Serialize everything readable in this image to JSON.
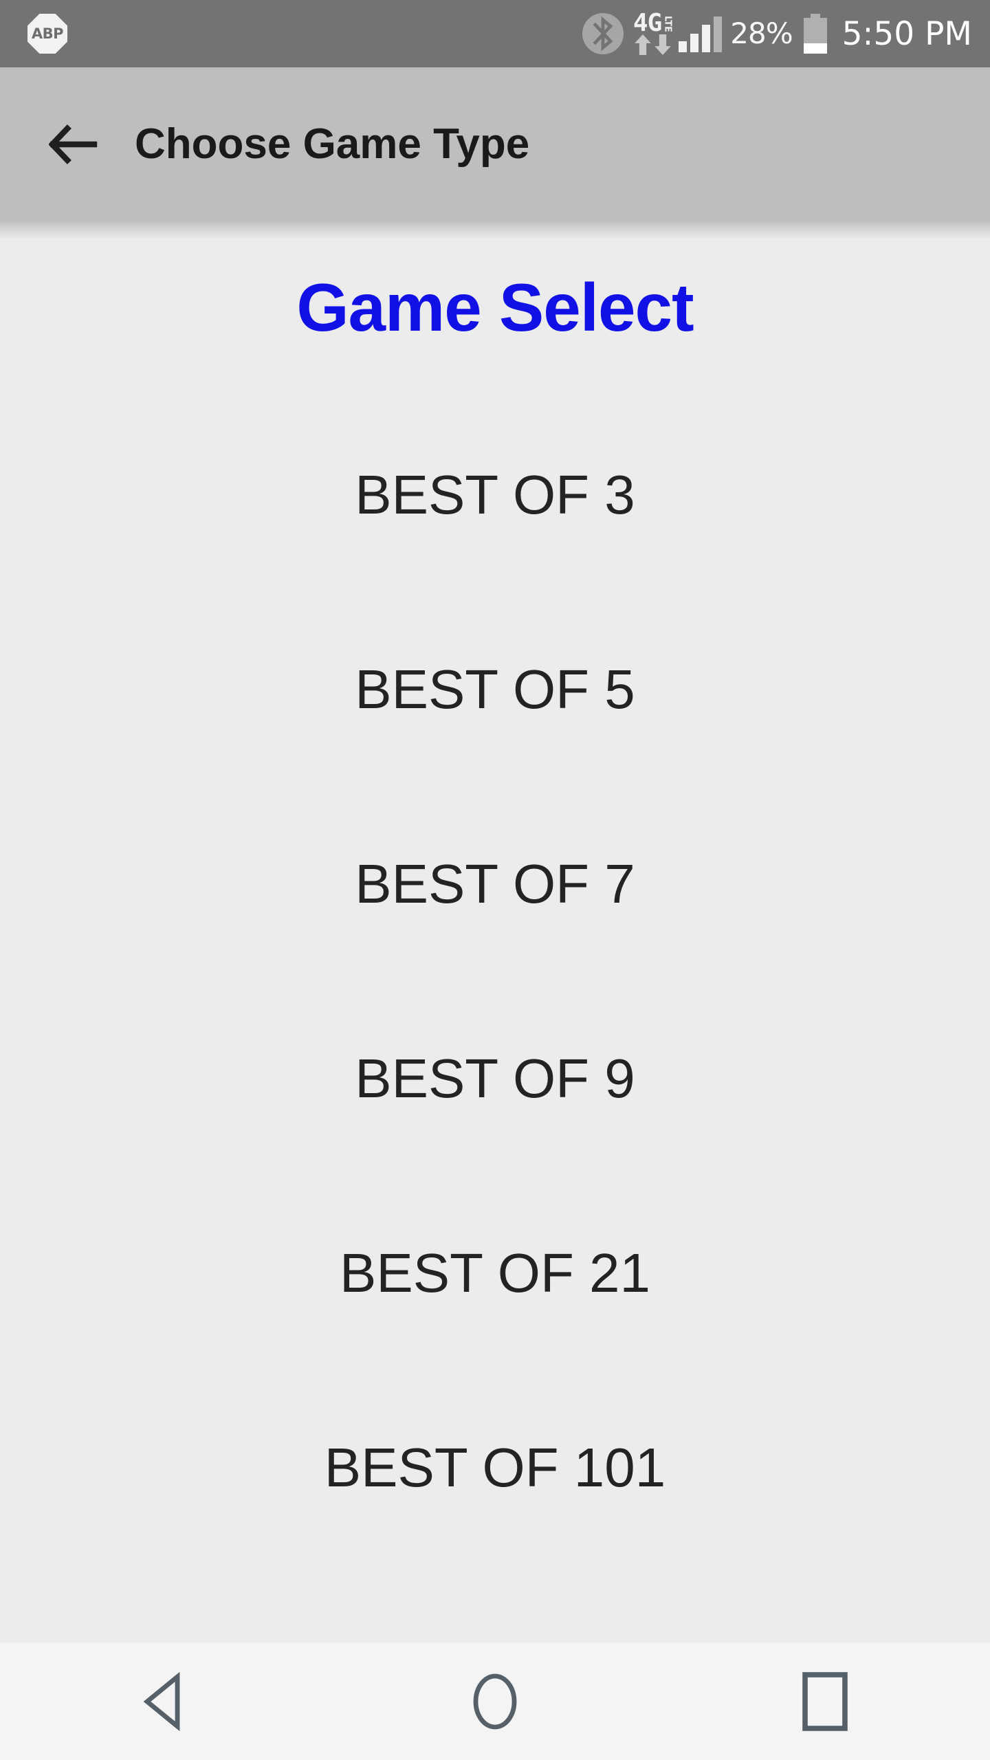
{
  "status_bar": {
    "app_icon_label": "ABP",
    "bluetooth_icon": "bluetooth-icon",
    "network_type": "4G",
    "network_suffix": "LTE",
    "data_up_icon": "data-upload-arrow-icon",
    "data_down_icon": "data-download-arrow-icon",
    "signal_icon": "signal-bars-icon",
    "signal_bars_total": 4,
    "signal_bars_active": 3,
    "battery_percent_label": "28%",
    "battery_level": 28,
    "time": "5:50 PM",
    "background_color": "#737373",
    "foreground_color": "#f2f2f2"
  },
  "app_bar": {
    "back_icon": "arrow-left-icon",
    "title": "Choose Game Type",
    "background_color": "#bebebe",
    "title_color": "#1a1a1a"
  },
  "main": {
    "heading": "Game Select",
    "heading_color": "#1111e6",
    "background_color": "#ececec",
    "item_color": "#232323",
    "game_types": [
      {
        "label": "BEST OF 3",
        "rounds": 3
      },
      {
        "label": "BEST OF 5",
        "rounds": 5
      },
      {
        "label": "BEST OF 7",
        "rounds": 7
      },
      {
        "label": "BEST OF 9",
        "rounds": 9
      },
      {
        "label": "BEST OF 21",
        "rounds": 21
      },
      {
        "label": "BEST OF 101",
        "rounds": 101
      }
    ]
  },
  "nav_bar": {
    "background_color": "#f4f4f4",
    "icon_color": "#556068",
    "buttons": [
      {
        "name": "back-triangle-icon",
        "label": "Back"
      },
      {
        "name": "home-circle-icon",
        "label": "Home"
      },
      {
        "name": "recents-square-icon",
        "label": "Recents"
      }
    ]
  }
}
